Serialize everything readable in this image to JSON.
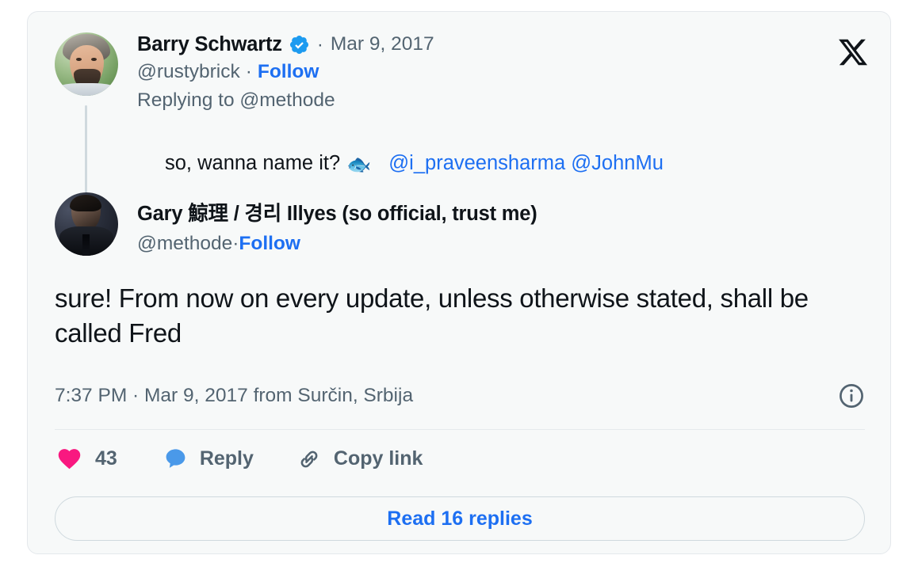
{
  "card": {
    "brand_logo": "x-logo",
    "accent_blue": "#1d6ff2",
    "like_pink": "#f91880",
    "reply_blue": "#4a99e9",
    "text_gray": "#536471",
    "text_dark": "#0f1419"
  },
  "thread_tweet": {
    "author_name": "Barry Schwartz",
    "verified": true,
    "separator": "·",
    "date": "Mar 9, 2017",
    "handle": "@rustybrick",
    "follow_label": "Follow",
    "replying_to": "Replying to @methode",
    "body_text": "so, wanna name it?",
    "emoji": "🐟",
    "mention_1": "@i_praveensharma",
    "mention_2": "@JohnMu"
  },
  "main_tweet": {
    "author_name": "Gary 鯨理 / 경리 Illyes (so official, trust me)",
    "handle": "@methode",
    "separator": "·",
    "follow_label": "Follow",
    "body_text": "sure! From now on every update, unless otherwise stated, shall be called Fred",
    "meta_line": "7:37 PM · Mar 9, 2017 from Surčin, Srbija",
    "info_icon": "info-circle-icon"
  },
  "actions": {
    "like_icon": "heart-icon",
    "like_count": "43",
    "reply_icon": "speech-bubble-icon",
    "reply_label": "Reply",
    "copy_link_icon": "link-icon",
    "copy_link_label": "Copy link"
  },
  "footer": {
    "read_replies_label": "Read 16 replies"
  }
}
